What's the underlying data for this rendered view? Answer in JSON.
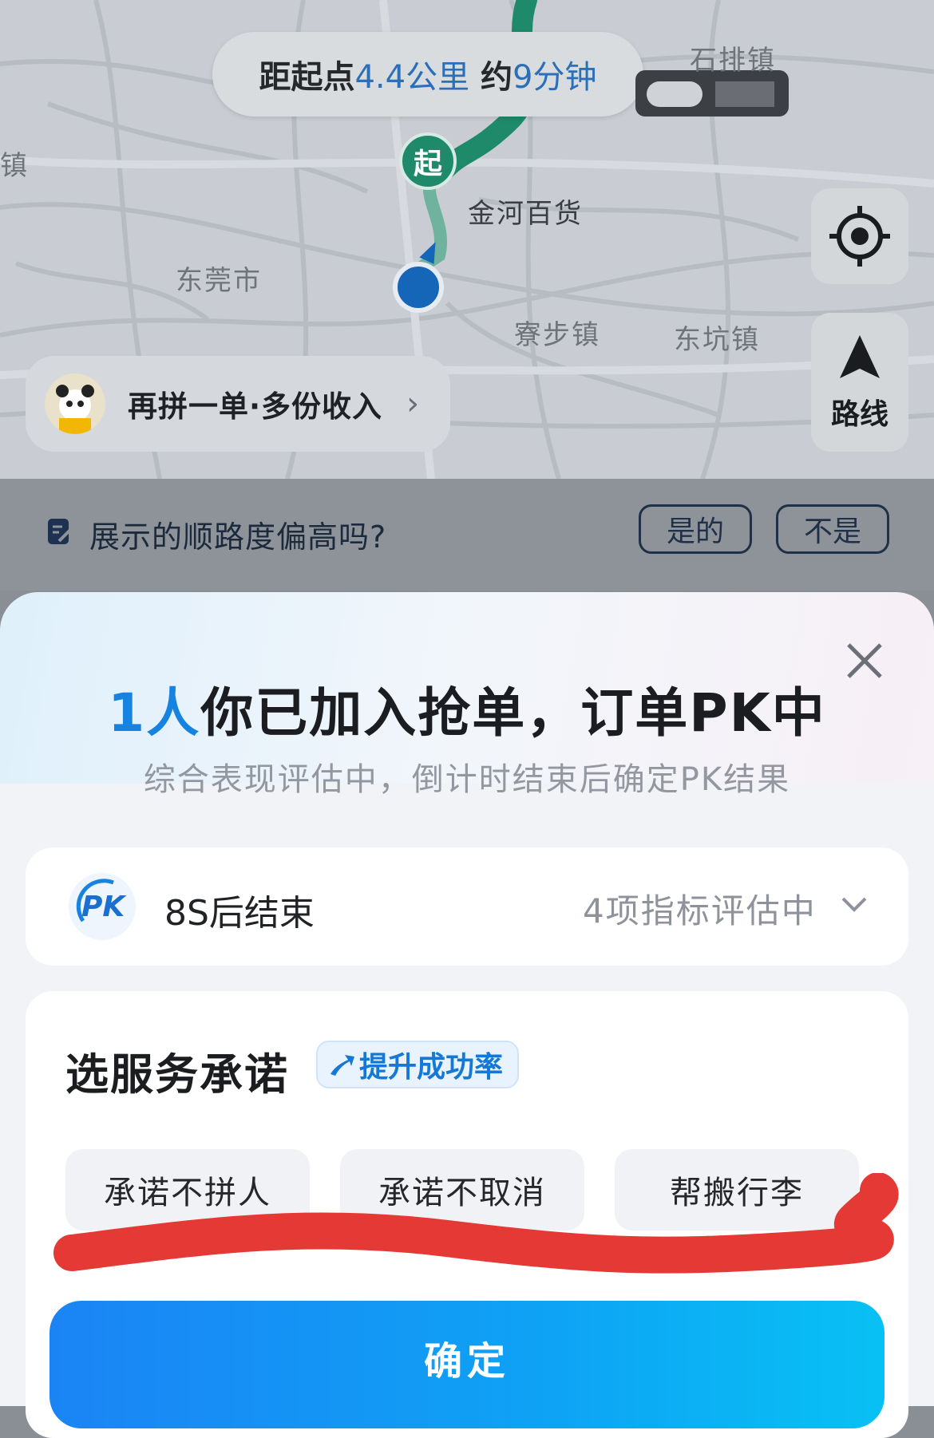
{
  "map": {
    "distance_prefix": "距起点",
    "distance_value": "4.4公里",
    "duration_prefix": "约",
    "duration_value": "9分钟",
    "start_marker": "起",
    "places": {
      "shipaizhen": "石排镇",
      "zhen": "镇",
      "jinhe": "金河百货",
      "dongguan": "东莞市",
      "liaobu": "寮步镇",
      "dongkeng": "东坑镇"
    },
    "route_button_label": "路线",
    "promo_label": "再拼一单·多份收入",
    "promo_arrow": "›"
  },
  "feedback": {
    "question": "展示的顺路度偏高吗?",
    "yes_label": "是的",
    "no_label": "不是"
  },
  "sheet": {
    "title_count": "1人",
    "title_text": "你已加入抢单，订单PK中",
    "subtitle": "综合表现评估中，倒计时结束后确定PK结果",
    "pk": {
      "logo_text": "PK",
      "countdown": "8S后结束",
      "metrics": "4项指标评估中"
    },
    "service": {
      "title": "选服务承诺",
      "badge": "提升成功率",
      "options": [
        "承诺不拼人",
        "承诺不取消",
        "帮搬行李"
      ]
    },
    "confirm_label": "确定"
  },
  "colors": {
    "accent_blue": "#1783e0",
    "route_green": "#1e8a6a",
    "scribble_red": "#e53935"
  }
}
